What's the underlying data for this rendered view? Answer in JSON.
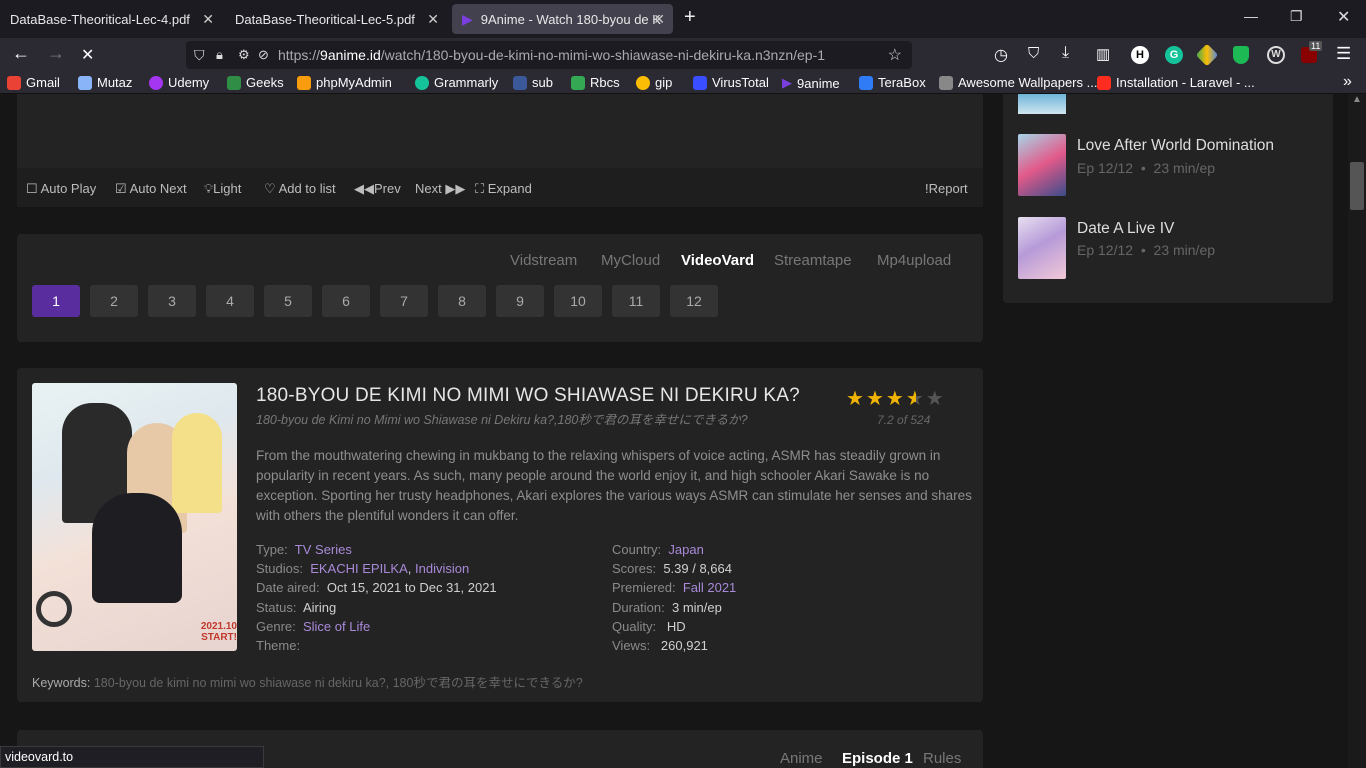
{
  "tabs": [
    {
      "label": "DataBase-Theoritical-Lec-4.pdf"
    },
    {
      "label": "DataBase-Theoritical-Lec-5.pdf"
    },
    {
      "label": "9Anime - Watch 180-byou de K"
    }
  ],
  "url": {
    "prefix": "https://",
    "host": "9anime.id",
    "path": "/watch/180-byou-de-kimi-no-mimi-wo-shiawase-ni-dekiru-ka.n3nzn/ep-1"
  },
  "extensions_badge": "11",
  "bookmarks": [
    "Gmail",
    "Mutaz",
    "Udemy",
    "Geeks",
    "phpMyAdmin",
    "Grammarly",
    "sub",
    "Rbcs",
    "gip",
    "VirusTotal",
    "9anime",
    "TeraBox",
    "Awesome Wallpapers ...",
    "Installation - Laravel - ..."
  ],
  "controls": {
    "autoplay": "Auto Play",
    "autonext": "Auto Next",
    "light": "Light",
    "addlist": "Add to list",
    "prev": "Prev",
    "next": "Next",
    "expand": "Expand",
    "report": "Report"
  },
  "servers": [
    "Vidstream",
    "MyCloud",
    "VideoVard",
    "Streamtape",
    "Mp4upload"
  ],
  "active_server": "VideoVard",
  "episodes": [
    "1",
    "2",
    "3",
    "4",
    "5",
    "6",
    "7",
    "8",
    "9",
    "10",
    "11",
    "12"
  ],
  "anime": {
    "title": "180-BYOU DE KIMI NO MIMI WO SHIAWASE NI DEKIRU KA?",
    "alt": "180-byou de Kimi no Mimi wo Shiawase ni Dekiru ka?,180秒で君の耳を幸せにできるか?",
    "rating": "7.2 of 524",
    "stars": 3.5,
    "description": "From the mouthwatering chewing in mukbang to the relaxing whispers of voice acting, ASMR has steadily grown in popularity in recent years. As such, many people around the world enjoy it, and high schooler Akari Sawake is no exception. Sporting her trusty headphones, Akari explores the various ways ASMR can stimulate her senses and shares with others the plentiful wonders it can offer.",
    "type_label": "Type:",
    "type": "TV Series",
    "studios_label": "Studios:",
    "studio1": "EKACHI EPILKA",
    "studio2": "Indivision",
    "aired_label": "Date aired:",
    "aired": "Oct 15, 2021 to Dec 31, 2021",
    "status_label": "Status:",
    "status": "Airing",
    "genre_label": "Genre:",
    "genre": "Slice of Life",
    "theme_label": "Theme:",
    "country_label": "Country:",
    "country": "Japan",
    "scores_label": "Scores:",
    "scores": "5.39 / 8,664",
    "premiered_label": "Premiered:",
    "premiered": "Fall 2021",
    "duration_label": "Duration:",
    "duration": "3 min/ep",
    "quality_label": "Quality:",
    "quality": "HD",
    "views_label": "Views:",
    "views": "260,921",
    "keywords_label": "Keywords:",
    "keywords": "180-byou de kimi no mimi wo shiawase ni dekiru ka?, 180秒で君の耳を幸せにできるか?",
    "poster_text": "2021.10 START!"
  },
  "bottom_tabs": [
    "Anime",
    "Episode 1",
    "Rules"
  ],
  "sidebar": [
    {
      "title": "Love After World Domination",
      "ep": "Ep 12/12",
      "dur": "23 min/ep"
    },
    {
      "title": "Date A Live IV",
      "ep": "Ep 12/12",
      "dur": "23 min/ep"
    }
  ],
  "status_url": "videovard.to"
}
